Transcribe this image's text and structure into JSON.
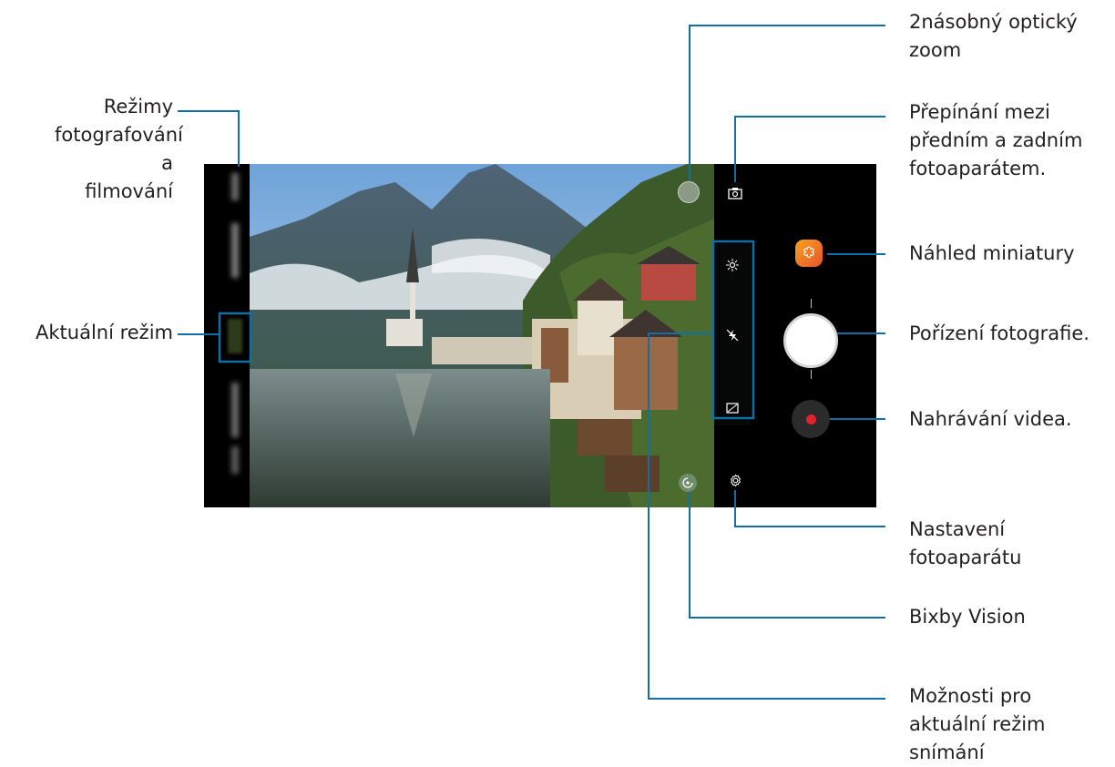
{
  "labels": {
    "zoom": "2násobný optický\nzoom",
    "modes": "Režimy\nfotografování a\nfilmování",
    "switch_camera": "Přepínání mezi\npředním a zadním\nfotoaparátem.",
    "preview": "Náhled miniatury",
    "current_mode": "Aktuální režim",
    "take_photo": "Pořízení fotografie.",
    "record_video": "Nahrávání videa.",
    "settings": "Nastavení\nfotoaparátu",
    "bixby": "Bixby Vision",
    "options": "Možnosti pro\naktuální režim\nsnímání"
  },
  "icons": {
    "switch_camera": "switch-camera-icon",
    "bixby": "bixby-vision-icon",
    "settings": "gear-icon",
    "gallery": "gallery-flower-icon",
    "brightness": "brightness-icon",
    "flash_off": "flash-off-icon",
    "ratio": "aspect-ratio-icon",
    "zoom": "zoom-button"
  },
  "colors": {
    "callout": "#0f6fa6",
    "text": "#231f20",
    "record": "#e3202e",
    "gallery_start": "#f6a21f",
    "gallery_end": "#e9532c"
  }
}
